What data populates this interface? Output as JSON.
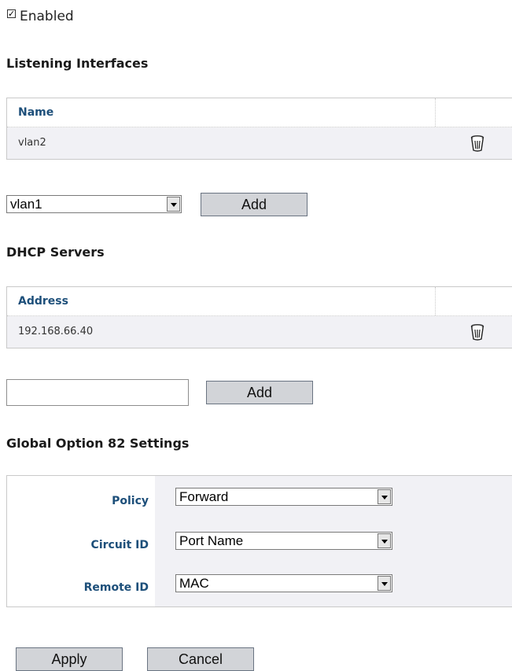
{
  "enabled": {
    "label": "Enabled",
    "checked": true
  },
  "listening": {
    "title": "Listening Interfaces",
    "column": "Name",
    "rows": [
      "vlan2"
    ],
    "select_value": "vlan1",
    "add_label": "Add"
  },
  "dhcp": {
    "title": "DHCP Servers",
    "column": "Address",
    "rows": [
      "192.168.66.40"
    ],
    "input_value": "",
    "add_label": "Add"
  },
  "option82": {
    "title": "Global Option 82 Settings",
    "policy": {
      "label": "Policy",
      "value": "Forward"
    },
    "circuit": {
      "label": "Circuit ID",
      "value": "Port Name"
    },
    "remote": {
      "label": "Remote ID",
      "value": "MAC"
    }
  },
  "actions": {
    "apply": "Apply",
    "cancel": "Cancel"
  },
  "icons": {
    "delete": "trash-icon"
  }
}
